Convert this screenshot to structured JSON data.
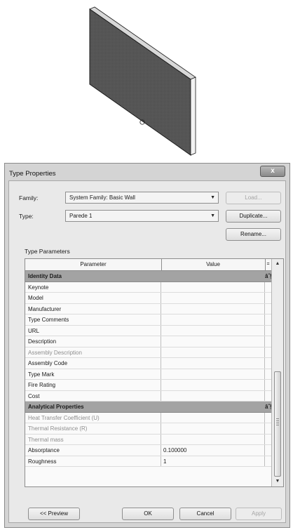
{
  "dialog": {
    "title": "Type Properties",
    "close_glyph": "x",
    "family_label": "Family:",
    "family_value": "System Family: Basic Wall",
    "type_label": "Type:",
    "type_value": "Parede 1",
    "load_label": "Load...",
    "duplicate_label": "Duplicate...",
    "rename_label": "Rename...",
    "type_parameters_label": "Type Parameters"
  },
  "grid": {
    "header_parameter": "Parameter",
    "header_value": "Value",
    "sort_glyph": "=",
    "collapse_glyph": "âˆ§",
    "rows": [
      {
        "param": "Identity Data",
        "value": "",
        "group": true
      },
      {
        "param": "Keynote",
        "value": ""
      },
      {
        "param": "Model",
        "value": ""
      },
      {
        "param": "Manufacturer",
        "value": ""
      },
      {
        "param": "Type Comments",
        "value": ""
      },
      {
        "param": "URL",
        "value": ""
      },
      {
        "param": "Description",
        "value": ""
      },
      {
        "param": "Assembly Description",
        "value": "",
        "disabled": true
      },
      {
        "param": "Assembly Code",
        "value": ""
      },
      {
        "param": "Type Mark",
        "value": ""
      },
      {
        "param": "Fire Rating",
        "value": ""
      },
      {
        "param": "Cost",
        "value": ""
      },
      {
        "param": "Analytical Properties",
        "value": "",
        "group": true
      },
      {
        "param": "Heat Transfer Coefficient (U)",
        "value": "",
        "disabled": true
      },
      {
        "param": "Thermal Resistance (R)",
        "value": "",
        "disabled": true
      },
      {
        "param": "Thermal mass",
        "value": "",
        "disabled": true
      },
      {
        "param": "Absorptance",
        "value": "0.100000"
      },
      {
        "param": "Roughness",
        "value": "1"
      }
    ]
  },
  "footer": {
    "preview_label": "<< Preview",
    "ok_label": "OK",
    "cancel_label": "Cancel",
    "apply_label": "Apply"
  },
  "icons": {
    "dropdown": "dropdown-arrow-icon",
    "close": "close-icon",
    "scroll_up": "scroll-up-arrow-icon",
    "scroll_down": "scroll-down-arrow-icon"
  },
  "colors": {
    "dialog_frame": "#d4d4d4",
    "client_bg": "#e9e9e9",
    "group_row": "#a3a3a3",
    "wall_face": "#555555"
  }
}
